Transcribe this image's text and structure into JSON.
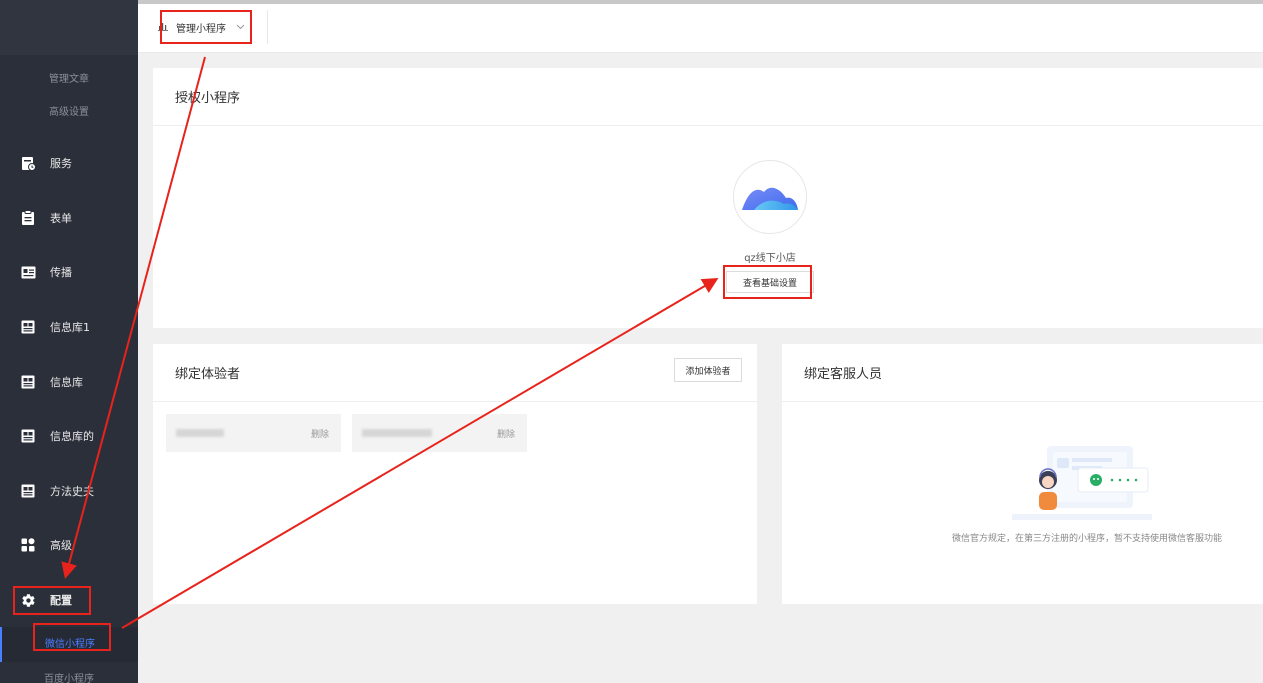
{
  "sidebar": {
    "sub_top": [
      "管理文章",
      "高级设置"
    ],
    "items": [
      {
        "label": "服务",
        "icon": "service-icon"
      },
      {
        "label": "表单",
        "icon": "clipboard-icon"
      },
      {
        "label": "传播",
        "icon": "card-icon"
      },
      {
        "label": "信息库1",
        "icon": "grid-icon"
      },
      {
        "label": "信息库",
        "icon": "grid-icon"
      },
      {
        "label": "信息库的",
        "icon": "grid-icon"
      },
      {
        "label": "方法史夫",
        "icon": "grid-icon"
      },
      {
        "label": "高级",
        "icon": "apps-icon"
      },
      {
        "label": "配置",
        "icon": "gear-icon"
      }
    ],
    "sub_bottom_active": "微信小程序",
    "sub_bottom": "百度小程序"
  },
  "topbar": {
    "dropdown_label": "管理小程序"
  },
  "auth_card": {
    "title": "授权小程序",
    "app_name": "qz线下小店",
    "view_button": "查看基础设置"
  },
  "experience_card": {
    "title": "绑定体验者",
    "add_button": "添加体验者",
    "testers": [
      {
        "delete_label": "删除"
      },
      {
        "delete_label": "删除"
      }
    ]
  },
  "cs_card": {
    "title": "绑定客服人员",
    "note": "微信官方规定，在第三方注册的小程序，暂不支持使用微信客服功能"
  },
  "colors": {
    "sidebar_bg": "#2b2f3a",
    "accent": "#4a7fff",
    "annotation": "#e8231c"
  }
}
